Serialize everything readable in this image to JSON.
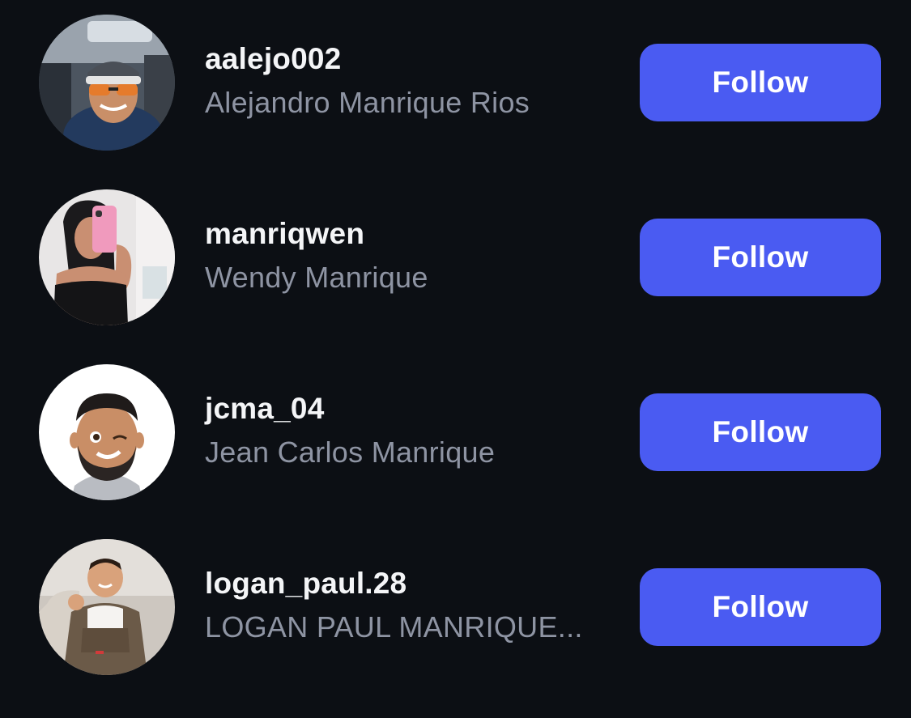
{
  "suggestions": [
    {
      "username": "aalejo002",
      "full_name": "Alejandro Manrique Rios",
      "follow_label": "Follow",
      "avatar_icon": "user-photo-avatar"
    },
    {
      "username": "manriqwen",
      "full_name": "Wendy Manrique",
      "follow_label": "Follow",
      "avatar_icon": "user-photo-avatar"
    },
    {
      "username": "jcma_04",
      "full_name": "Jean Carlos Manrique",
      "follow_label": "Follow",
      "avatar_icon": "memoji-avatar"
    },
    {
      "username": "logan_paul.28",
      "full_name": "LOGAN PAUL MANRIQUE...",
      "follow_label": "Follow",
      "avatar_icon": "user-photo-avatar"
    }
  ],
  "colors": {
    "background": "#0c0f14",
    "button": "#4a5bf2",
    "username_text": "#f4f5f7",
    "fullname_text": "#8e94a3"
  }
}
